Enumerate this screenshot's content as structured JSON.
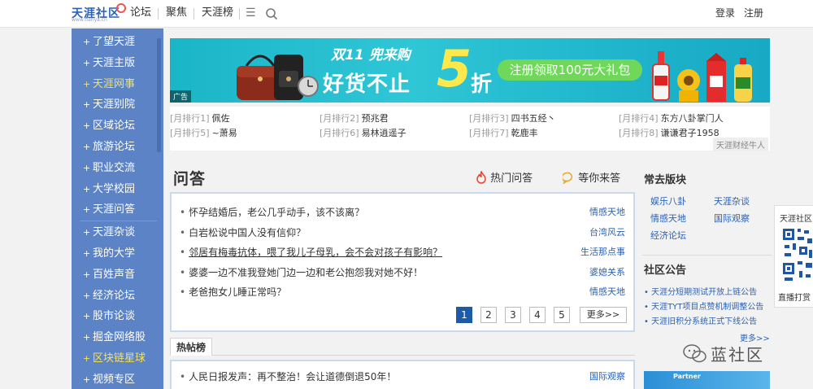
{
  "header": {
    "logo": {
      "name": "天涯社区",
      "sub": "www.tianya.cn"
    },
    "nav": [
      "论坛",
      "聚焦",
      "天涯榜"
    ],
    "menu_icon": "menu-icon",
    "search_icon": "search-icon",
    "login": "登录",
    "register": "注册"
  },
  "sidebar": {
    "items": [
      {
        "label": "了望天涯",
        "highlight": false
      },
      {
        "label": "天涯主版",
        "highlight": false
      },
      {
        "label": "天涯网事",
        "highlight": true
      },
      {
        "label": "天涯别院",
        "highlight": false
      },
      {
        "label": "区域论坛",
        "highlight": false
      },
      {
        "label": "旅游论坛",
        "highlight": false
      },
      {
        "label": "职业交流",
        "highlight": false
      },
      {
        "label": "大学校园",
        "highlight": false
      },
      {
        "label": "天涯问答",
        "highlight": false
      },
      {
        "label": "天涯杂谈",
        "highlight": false
      },
      {
        "label": "我的大学",
        "highlight": false
      },
      {
        "label": "百姓声音",
        "highlight": false
      },
      {
        "label": "经济论坛",
        "highlight": false
      },
      {
        "label": "股市论谈",
        "highlight": false
      },
      {
        "label": "掘金网络股",
        "highlight": false
      },
      {
        "label": "区块链星球",
        "highlight": true
      },
      {
        "label": "视频专区",
        "highlight": false
      }
    ]
  },
  "banner": {
    "brand": "双11 兜来购",
    "headline": "好货不止",
    "number": "5",
    "unit": "折",
    "cta": "注册领取100元大礼包",
    "ad_label": "广告"
  },
  "ranks": [
    {
      "tag": "[月排行1]",
      "name": "佩佐"
    },
    {
      "tag": "[月排行2]",
      "name": "预兆君"
    },
    {
      "tag": "[月排行3]",
      "name": "四书五经丶"
    },
    {
      "tag": "[月排行4]",
      "name": "东方八卦掌门人"
    },
    {
      "tag": "[月排行5]",
      "name": "~萧易"
    },
    {
      "tag": "[月排行6]",
      "name": "易林逍遥子"
    },
    {
      "tag": "[月排行7]",
      "name": "乾鹿丰"
    },
    {
      "tag": "[月排行8]",
      "name": "谦谦君子1958"
    }
  ],
  "rank_author": "天涯财经牛人",
  "qa": {
    "title": "问答",
    "tabs": [
      "热门问答",
      "等你来答"
    ],
    "items": [
      {
        "q": "怀孕结婚后，老公几乎动手，该不该离？",
        "c": "情感天地",
        "underline": false
      },
      {
        "q": "白岩松说中国人没有信仰？",
        "c": "台湾风云",
        "underline": false
      },
      {
        "q": "邻居有梅毒抗体，喂了我儿子母乳，会不会对孩子有影响？",
        "c": "生活那点事",
        "underline": true
      },
      {
        "q": "婆婆一边不准我登她门边一边和老公抱怨我对她不好！",
        "c": "婆媳关系",
        "underline": false
      },
      {
        "q": "老爸抱女儿睡正常吗？",
        "c": "情感天地",
        "underline": false
      }
    ],
    "pages": [
      "1",
      "2",
      "3",
      "4",
      "5"
    ],
    "more": "更多>>"
  },
  "hot": {
    "tab": "热帖榜",
    "items": [
      {
        "q": "人民日报发声：再不整治！会让道德倒退50年！",
        "c": "国际观察"
      }
    ]
  },
  "right": {
    "boards_title": "常去版块",
    "boards": [
      "娱乐八卦",
      "天涯杂谈",
      "情感天地",
      "国际观察",
      "经济论坛"
    ],
    "notice_title": "社区公告",
    "notices": [
      "天涯分短期测试开放上链公告",
      "天涯TYT项目点赞机制调整公告",
      "天涯旧积分系统正式下线公告"
    ],
    "more": "更多>>",
    "partner": "Partner"
  },
  "float_qr": {
    "top": "天涯社区",
    "bottom": "直播打赏"
  },
  "watermark": "蓝社区",
  "colors": {
    "sidebar": "#5b83c5",
    "highlight": "#f5e25a",
    "link": "#2a62b8",
    "accent": "#1d5aa8"
  }
}
